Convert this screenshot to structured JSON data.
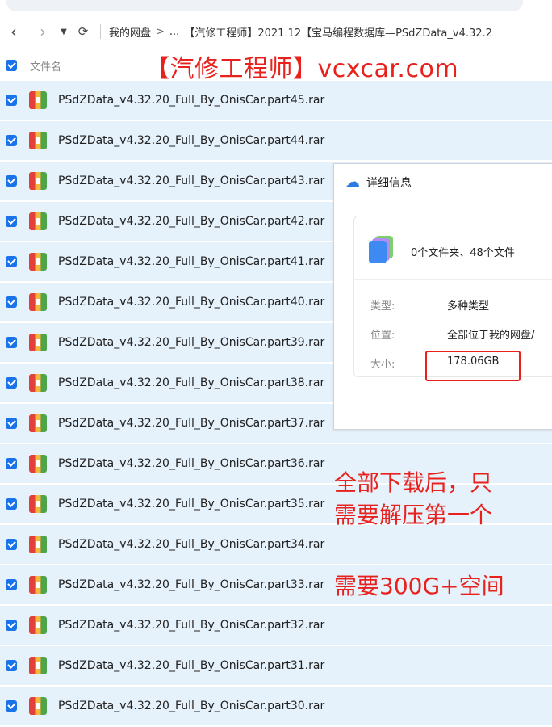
{
  "nav": {
    "back_icon": "chevron-left-icon",
    "forward_icon": "chevron-right-icon",
    "dropdown_icon": "caret-down-icon",
    "refresh_icon": "refresh-icon",
    "crumbs": [
      "我的网盘",
      "...",
      "【汽修工程师】2021.12【宝马编程数据库—PSdZData_v4.32.2"
    ],
    "crumb_sep": ">"
  },
  "header": {
    "column_label": "文件名",
    "watermark": "【汽修工程师】vcxcar.com"
  },
  "files": [
    "PSdZData_v4.32.20_Full_By_OnisCar.part45.rar",
    "PSdZData_v4.32.20_Full_By_OnisCar.part44.rar",
    "PSdZData_v4.32.20_Full_By_OnisCar.part43.rar",
    "PSdZData_v4.32.20_Full_By_OnisCar.part42.rar",
    "PSdZData_v4.32.20_Full_By_OnisCar.part41.rar",
    "PSdZData_v4.32.20_Full_By_OnisCar.part40.rar",
    "PSdZData_v4.32.20_Full_By_OnisCar.part39.rar",
    "PSdZData_v4.32.20_Full_By_OnisCar.part38.rar",
    "PSdZData_v4.32.20_Full_By_OnisCar.part37.rar",
    "PSdZData_v4.32.20_Full_By_OnisCar.part36.rar",
    "PSdZData_v4.32.20_Full_By_OnisCar.part35.rar",
    "PSdZData_v4.32.20_Full_By_OnisCar.part34.rar",
    "PSdZData_v4.32.20_Full_By_OnisCar.part33.rar",
    "PSdZData_v4.32.20_Full_By_OnisCar.part32.rar",
    "PSdZData_v4.32.20_Full_By_OnisCar.part31.rar",
    "PSdZData_v4.32.20_Full_By_OnisCar.part30.rar"
  ],
  "details": {
    "title": "详细信息",
    "summary": "0个文件夹、48个文件",
    "type_label": "类型:",
    "type_value": "多种类型",
    "location_label": "位置:",
    "location_value": "全部位于我的网盘/",
    "size_label": "大小:",
    "size_value": "178.06GB"
  },
  "annotations": {
    "line1": "全部下载后，只",
    "line2": "需要解压第一个",
    "line3": "需要300G+空间"
  },
  "colors": {
    "accent": "#1a73e8",
    "row_bg": "#e5f1fb",
    "annotation_red": "#e8211d"
  }
}
